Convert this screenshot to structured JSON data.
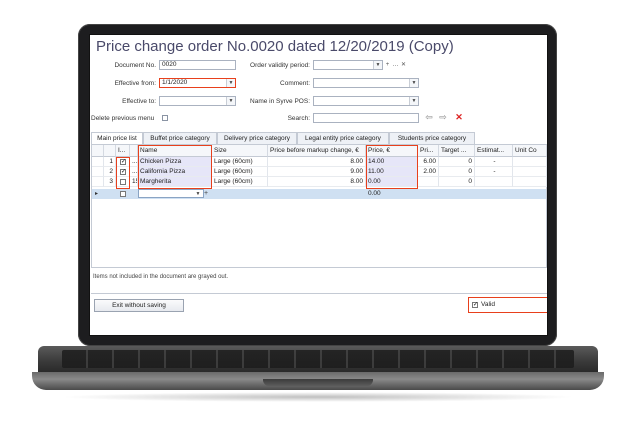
{
  "window": {
    "title": "Price change order No.0020 dated 12/20/2019 (Copy)"
  },
  "form": {
    "document_no_label": "Document No.",
    "document_no": "0020",
    "effective_from_label": "Effective from:",
    "effective_from": "1/1/2020",
    "effective_to_label": "Effective to:",
    "effective_to": "",
    "order_validity_label": "Order validity period:",
    "comment_label": "Comment:",
    "name_pos_label": "Name in Syrve POS:",
    "search_label": "Search:",
    "delete_previous_menu_label": "Delete previous menu"
  },
  "tabs": [
    {
      "label": "Main price list"
    },
    {
      "label": "Buffet price category"
    },
    {
      "label": "Delivery price category"
    },
    {
      "label": "Legal entity price category"
    },
    {
      "label": "Students price category"
    }
  ],
  "grid": {
    "headers": [
      "I...",
      "Name",
      "Size",
      "Price before markup change, €",
      "Price, €",
      "Pri...",
      "Target ...",
      "Estimat...",
      "Unit Co"
    ],
    "rows": [
      {
        "num": "1",
        "checked": true,
        "mark": "...",
        "name": "Chicken Pizza",
        "size": "Large (60cm)",
        "before": "8.00",
        "price": "14.00",
        "pri": "6.00",
        "target": "0",
        "estim": "-"
      },
      {
        "num": "2",
        "checked": true,
        "mark": "...",
        "name": "California Pizza",
        "size": "Large (60cm)",
        "before": "9.00",
        "price": "11.00",
        "pri": "2.00",
        "target": "0",
        "estim": "-"
      },
      {
        "num": "3",
        "checked": false,
        "mark": "15",
        "name": "Margherita",
        "size": "Large (60cm)",
        "before": "8.00",
        "price": "0.00",
        "pri": "",
        "target": "0",
        "estim": ""
      }
    ],
    "new_row_price": "0.00"
  },
  "footer": {
    "note": "Items not included in the document are grayed out.",
    "exit_label": "Exit without saving",
    "valid_label": "Valid",
    "valid_checked": true
  },
  "icons": {
    "arrow_left": "arrow-left-icon",
    "arrow_right": "arrow-right-icon",
    "clear": "close-x-icon"
  },
  "colors": {
    "highlight": "#e8401c",
    "selected_row": "#cfe0f2",
    "edited_cell": "#e6e6f8"
  }
}
